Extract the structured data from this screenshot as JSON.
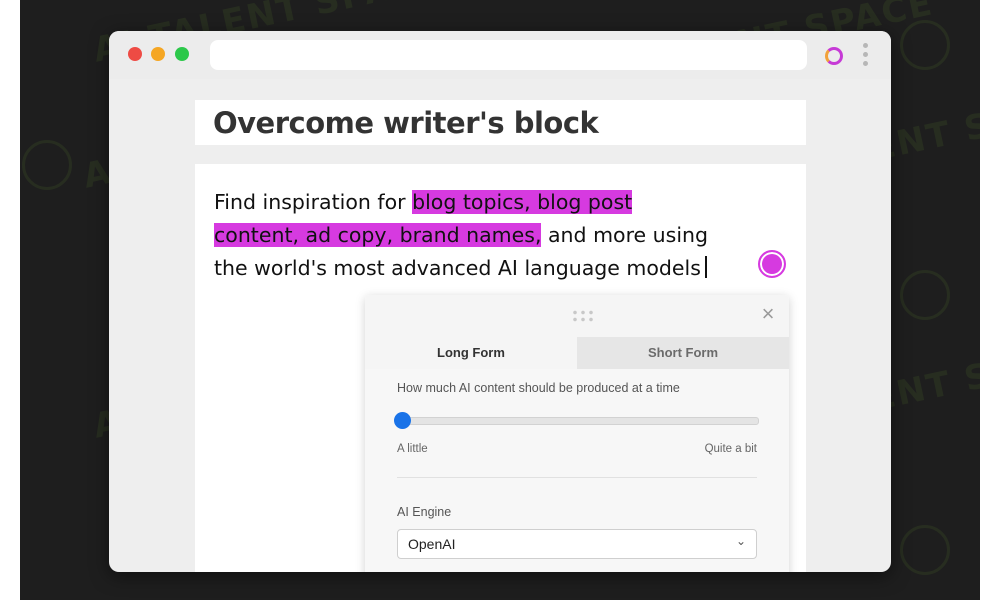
{
  "watermark": {
    "text": "AI TALENT SPACE"
  },
  "browser": {
    "url": "",
    "extension_icon": "extension-ring-icon",
    "menu_icon": "kebab-menu-icon"
  },
  "page": {
    "title": "Overcome writer's block",
    "body_plain_start": "Find inspiration for ",
    "body_highlight_1": "blog topics, blog post",
    "body_highlight_2": "content, ad copy, brand names,",
    "body_plain_mid": " and more using",
    "body_plain_end": "the world's most advanced AI language models",
    "highlight_color": "#d63ae0"
  },
  "panel": {
    "close_icon": "close-icon",
    "drag_icon": "drag-handle-icon",
    "tabs": [
      {
        "label": "Long Form",
        "active": true
      },
      {
        "label": "Short Form",
        "active": false
      }
    ],
    "content_amount": {
      "label": "How much AI content should be produced at a time",
      "min_label": "A little",
      "max_label": "Quite a bit",
      "value": 0.0
    },
    "engine": {
      "label": "AI Engine",
      "selected": "OpenAI"
    },
    "accent_color": "#1a73e8"
  }
}
